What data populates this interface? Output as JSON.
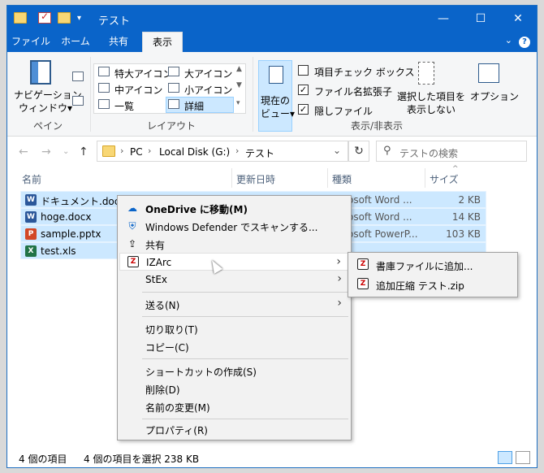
{
  "window": {
    "title": "テスト",
    "controls": [
      "minimize-icon",
      "maximize-icon",
      "close-icon"
    ]
  },
  "ribbon_tabs": [
    {
      "label": "ファイル"
    },
    {
      "label": "ホーム"
    },
    {
      "label": "共有"
    },
    {
      "label": "表示",
      "active": true
    }
  ],
  "ribbon": {
    "pane": {
      "nav_pane_line1": "ナビゲーション",
      "nav_pane_line2": "ウィンドウ▾",
      "group_label": "ペイン"
    },
    "layout": {
      "items": [
        "特大アイコン",
        "大アイコン",
        "中アイコン",
        "小アイコン",
        "一覧",
        "詳細"
      ],
      "selected": "詳細",
      "group_label": "レイアウト"
    },
    "current_view": {
      "line1": "現在の",
      "line2": "ビュー▾"
    },
    "show_hide": {
      "item_checkbox": {
        "label": "項目チェック ボックス",
        "checked": false
      },
      "file_ext": {
        "label": "ファイル名拡張子",
        "checked": true
      },
      "hidden_files": {
        "label": "隠しファイル",
        "checked": true
      },
      "hide_selected_line1": "選択した項目を",
      "hide_selected_line2": "表示しない",
      "options": "オプション",
      "group_label": "表示/非表示"
    }
  },
  "address": {
    "segments": [
      "PC",
      "Local Disk (G:)",
      "テスト"
    ],
    "search_placeholder": "テストの検索"
  },
  "columns": {
    "name": "名前",
    "modified": "更新日時",
    "type": "種類",
    "size": "サイズ"
  },
  "files": [
    {
      "name": "ドキュメント.docx",
      "type": "osoft Word ...",
      "size": "2 KB",
      "icon": "word",
      "color": "#2b579a"
    },
    {
      "name": "hoge.docx",
      "type": "osoft Word ...",
      "size": "14 KB",
      "icon": "word",
      "color": "#2b579a"
    },
    {
      "name": "sample.pptx",
      "type": "osoft PowerP...",
      "size": "103 KB",
      "icon": "powerpoint",
      "color": "#d24726"
    },
    {
      "name": "test.xls",
      "type": "",
      "size": "",
      "icon": "excel",
      "color": "#217346"
    }
  ],
  "context_menu": {
    "items": [
      {
        "label": "OneDrive に移動(M)",
        "icon": "onedrive-icon",
        "bold": true
      },
      {
        "label": "Windows Defender でスキャンする...",
        "icon": "defender-icon"
      },
      {
        "label": "共有",
        "icon": "share-icon"
      },
      {
        "label": "IZArc",
        "icon": "izarc-icon",
        "submenu": true
      },
      {
        "label": "StEx",
        "submenu": true
      },
      {
        "label": "送る(N)",
        "submenu": true
      },
      {
        "label": "切り取り(T)"
      },
      {
        "label": "コピー(C)"
      },
      {
        "label": "ショートカットの作成(S)"
      },
      {
        "label": "削除(D)"
      },
      {
        "label": "名前の変更(M)"
      },
      {
        "label": "プロパティ(R)"
      }
    ],
    "submenu": [
      {
        "label": "書庫ファイルに追加..."
      },
      {
        "label": "追加圧縮 テスト.zip"
      }
    ]
  },
  "status": {
    "item_count": "4 個の項目",
    "selected": "4 個の項目を選択 238 KB"
  },
  "colors": {
    "titlebar": "#0a64c9",
    "selection": "#cce8ff",
    "ribbon_bg": "#f5f6f7",
    "menu_bg": "#f2f2f2"
  }
}
